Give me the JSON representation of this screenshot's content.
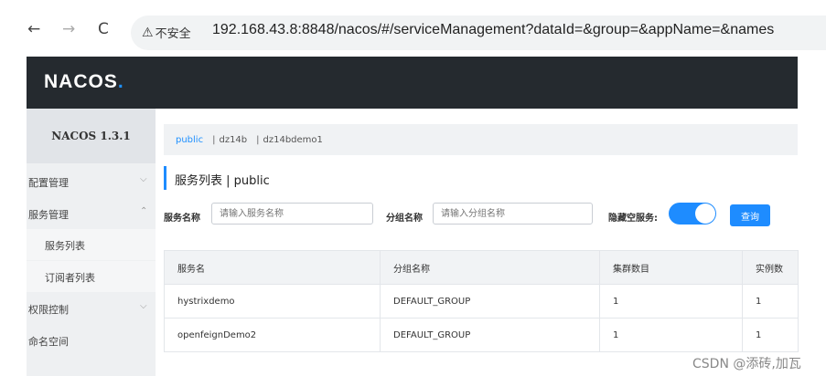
{
  "browser": {
    "back": "←",
    "forward": "→",
    "reload": "C",
    "security_text": "不安全",
    "url": "192.168.43.8:8848/nacos/#/serviceManagement?dataId=&group=&appName=&names"
  },
  "app": {
    "logo_text": "NACOS",
    "logo_dot": ".",
    "version": "NACOS 1.3.1"
  },
  "sidebar": {
    "items": [
      {
        "label": "配置管理",
        "chevron": "⌵"
      },
      {
        "label": "服务管理",
        "chevron": "⌃"
      },
      {
        "label": "服务列表"
      },
      {
        "label": "订阅者列表"
      },
      {
        "label": "权限控制",
        "chevron": "⌵"
      },
      {
        "label": "命名空间"
      }
    ]
  },
  "namespaces": {
    "items": [
      "public",
      "dz14b",
      "dz14bdemo1"
    ],
    "separator": "|"
  },
  "page": {
    "title": "服务列表  |  public"
  },
  "filters": {
    "service_name_label": "服务名称",
    "service_name_placeholder": "请输入服务名称",
    "group_name_label": "分组名称",
    "group_name_placeholder": "请输入分组名称",
    "hide_empty_label": "隐藏空服务:",
    "hide_empty_on": true,
    "query_button": "查询"
  },
  "table": {
    "headers": [
      "服务名",
      "分组名称",
      "集群数目",
      "实例数"
    ],
    "rows": [
      [
        "hystrixdemo",
        "DEFAULT_GROUP",
        "1",
        "1"
      ],
      [
        "openfeignDemo2",
        "DEFAULT_GROUP",
        "1",
        "1"
      ]
    ]
  },
  "watermark": "CSDN @添砖,加瓦",
  "colors": {
    "accent": "#1e8cff",
    "header_bg": "#252a2f",
    "sidebar_bg": "#eef0f2"
  }
}
